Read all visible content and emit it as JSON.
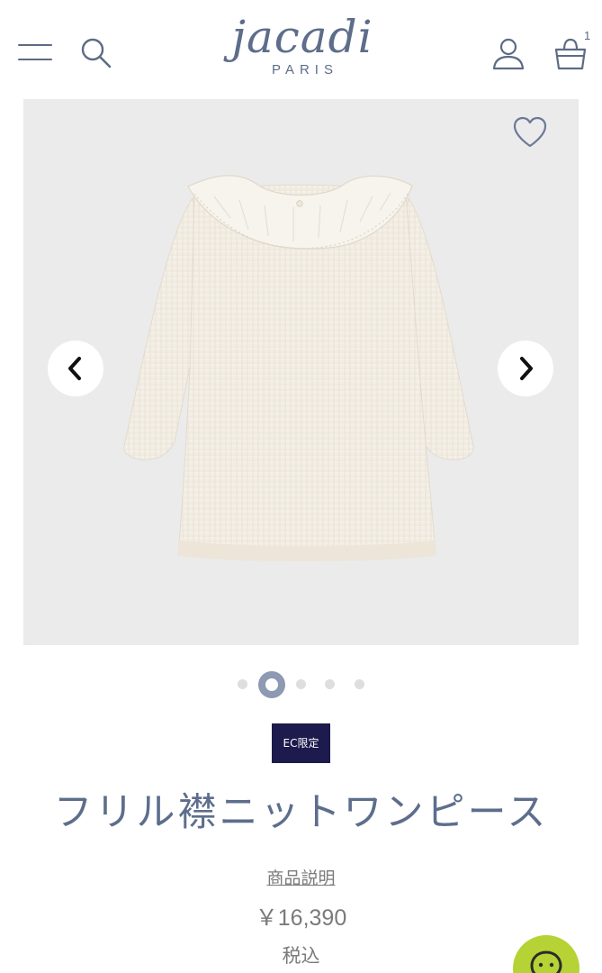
{
  "header": {
    "brand": "jacadi",
    "brand_sub": "PARIS",
    "cart_count": "1",
    "menu_icon": "hamburger-menu-icon",
    "search_icon": "search-icon",
    "account_icon": "user-icon",
    "cart_icon": "shopping-basket-icon"
  },
  "gallery": {
    "favorite_icon": "heart-icon",
    "prev_icon": "chevron-left-icon",
    "next_icon": "chevron-right-icon",
    "image_subject": "cream knit dress with ruffle collar",
    "slide_count": 5,
    "active_slide": 2
  },
  "product": {
    "badge": "EC限定",
    "title": "フリル襟ニットワンピース",
    "description_link": "商品説明",
    "price": "￥16,390",
    "tax_note": "税込"
  },
  "chat": {
    "icon": "chat-bubble-icon"
  },
  "colors": {
    "brand": "#5d6d8a",
    "badge_bg": "#1d1a4d",
    "chat_bg": "#b5d335",
    "gallery_bg": "#ebebeb"
  }
}
